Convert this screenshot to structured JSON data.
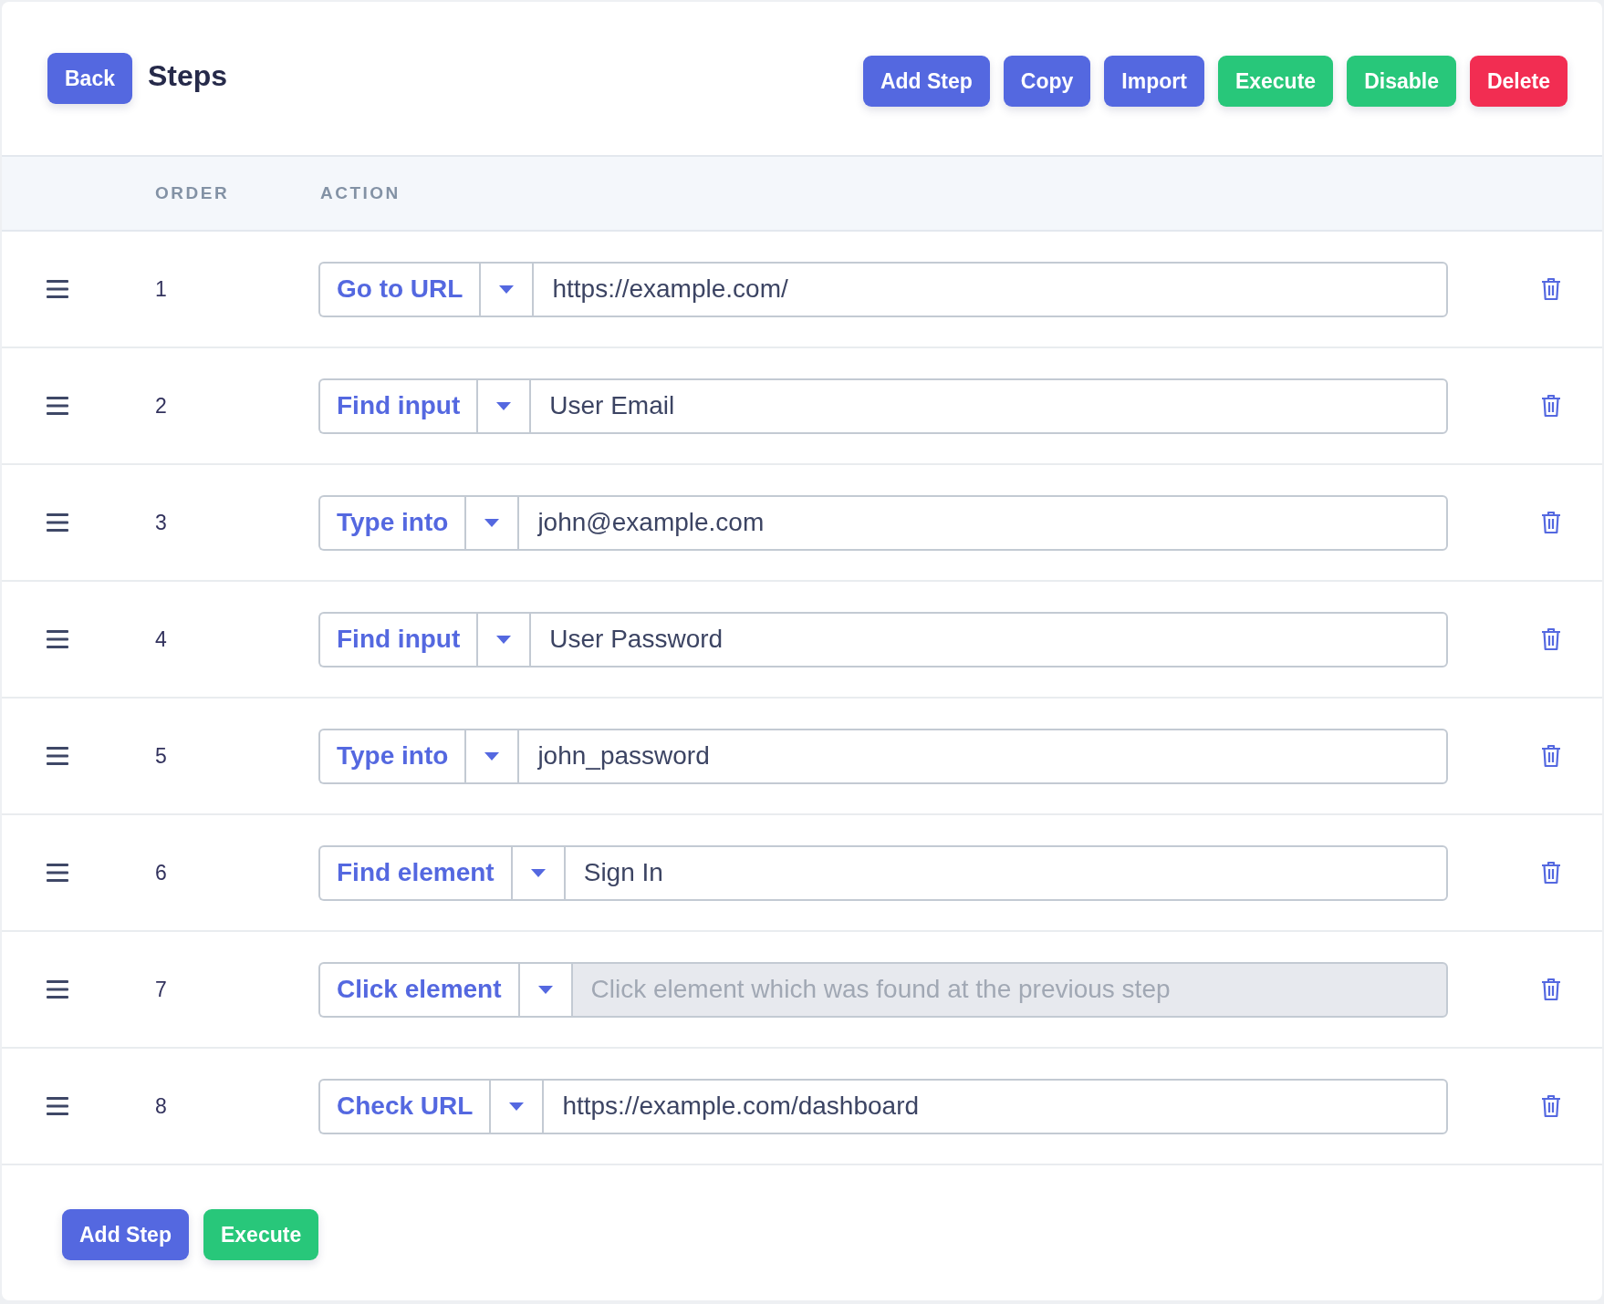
{
  "header": {
    "back_button": "Back",
    "title": "Steps",
    "actions": [
      {
        "label": "Add Step",
        "kind": "primary"
      },
      {
        "label": "Copy",
        "kind": "primary"
      },
      {
        "label": "Import",
        "kind": "primary"
      },
      {
        "label": "Execute",
        "kind": "success"
      },
      {
        "label": "Disable",
        "kind": "success"
      },
      {
        "label": "Delete",
        "kind": "danger"
      }
    ]
  },
  "table": {
    "columns": [
      "ORDER",
      "ACTION"
    ],
    "rows": [
      {
        "order": "1",
        "action": "Go to URL",
        "value": "https://example.com/",
        "disabled": false
      },
      {
        "order": "2",
        "action": "Find input",
        "value": "User Email",
        "disabled": false
      },
      {
        "order": "3",
        "action": "Type into",
        "value": "john@example.com",
        "disabled": false
      },
      {
        "order": "4",
        "action": "Find input",
        "value": "User Password",
        "disabled": false
      },
      {
        "order": "5",
        "action": "Type into",
        "value": "john_password",
        "disabled": false
      },
      {
        "order": "6",
        "action": "Find element",
        "value": "Sign In",
        "disabled": false
      },
      {
        "order": "7",
        "action": "Click element",
        "placeholder": "Click element which was found at the previous step",
        "disabled": true
      },
      {
        "order": "8",
        "action": "Check URL",
        "value": "https://example.com/dashboard",
        "disabled": false
      }
    ]
  },
  "footer": {
    "actions": [
      {
        "label": "Add Step",
        "kind": "primary"
      },
      {
        "label": "Execute",
        "kind": "success"
      }
    ]
  }
}
